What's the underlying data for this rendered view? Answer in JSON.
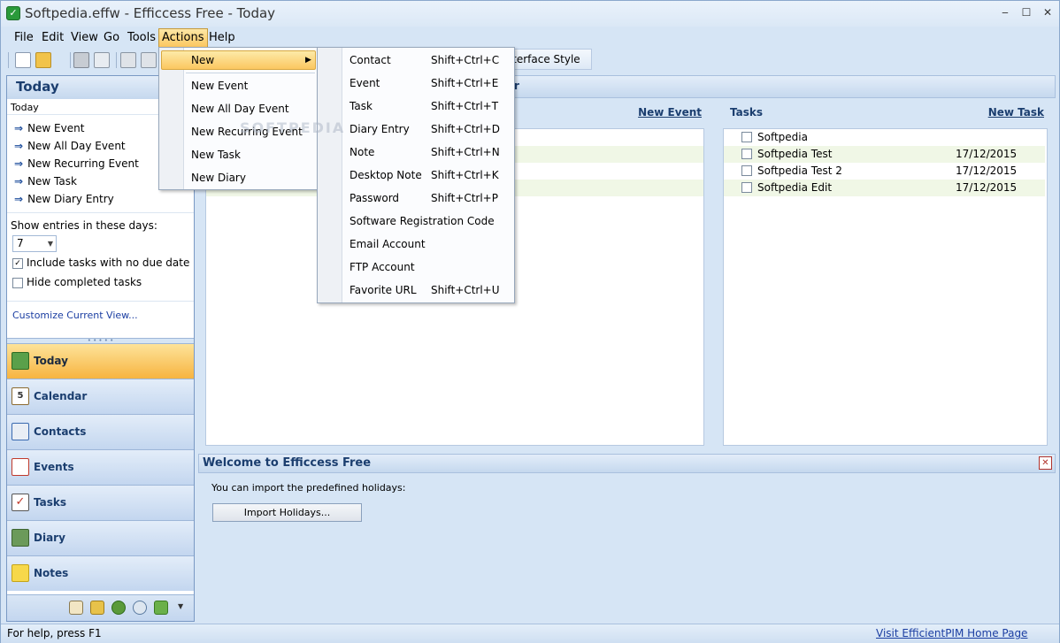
{
  "window": {
    "title": "Softpedia.effw - Efficcess Free - Today",
    "app_icon": "check-icon",
    "controls": [
      "minimize-icon",
      "maximize-icon",
      "close-icon"
    ]
  },
  "menubar": [
    "File",
    "Edit",
    "View",
    "Go",
    "Tools",
    "Actions",
    "Help"
  ],
  "toolbar": {
    "interface_style_label": "Interface Style"
  },
  "actions_menu": {
    "items": [
      "New",
      "New Event",
      "New All Day Event",
      "New Recurring Event",
      "New Task",
      "New Diary"
    ]
  },
  "new_submenu": {
    "items": [
      {
        "label": "Contact",
        "shortcut": "Shift+Ctrl+C"
      },
      {
        "label": "Event",
        "shortcut": "Shift+Ctrl+E"
      },
      {
        "label": "Task",
        "shortcut": "Shift+Ctrl+T"
      },
      {
        "label": "Diary Entry",
        "shortcut": "Shift+Ctrl+D"
      },
      {
        "label": "Note",
        "shortcut": "Shift+Ctrl+N"
      },
      {
        "label": "Desktop Note",
        "shortcut": "Shift+Ctrl+K"
      },
      {
        "label": "Password",
        "shortcut": "Shift+Ctrl+P"
      },
      {
        "label": "Software Registration Code",
        "shortcut": ""
      },
      {
        "label": "Email Account",
        "shortcut": ""
      },
      {
        "label": "FTP Account",
        "shortcut": ""
      },
      {
        "label": "Favorite URL",
        "shortcut": "Shift+Ctrl+U"
      }
    ]
  },
  "left_pane": {
    "header": "Today",
    "subheader": "Today",
    "links": [
      "New Event",
      "New All Day Event",
      "New Recurring Event",
      "New Task",
      "New Diary Entry"
    ],
    "show_entries_label": "Show entries in these days:",
    "days_value": "7",
    "include_tasks_label": "Include tasks with no due date",
    "include_tasks_checked": true,
    "hide_completed_label": "Hide completed tasks",
    "hide_completed_checked": false,
    "customize_link": "Customize Current View...",
    "nav": [
      "Today",
      "Calendar",
      "Contacts",
      "Events",
      "Tasks",
      "Diary",
      "Notes"
    ],
    "bottom_icons": [
      "clipboard-icon",
      "key-icon",
      "globe-icon",
      "search-icon",
      "refresh-icon",
      "chevron-down-icon"
    ]
  },
  "main": {
    "header_partial": "r",
    "events_panel": {
      "new_link": "New Event"
    },
    "tasks_panel": {
      "title": "Tasks",
      "new_link": "New Task",
      "rows": [
        {
          "name": "Softpedia",
          "date": ""
        },
        {
          "name": "Softpedia Test",
          "date": "17/12/2015"
        },
        {
          "name": "Softpedia Test 2",
          "date": "17/12/2015"
        },
        {
          "name": "Softpedia Edit",
          "date": "17/12/2015"
        }
      ]
    },
    "welcome": {
      "title": "Welcome to Efficcess Free",
      "text": "You can import the predefined holidays:",
      "button": "Import Holidays..."
    }
  },
  "statusbar": {
    "left": "For help, press F1",
    "right_link": "Visit EfficientPIM Home Page"
  },
  "watermark": "SOFTPEDIA"
}
